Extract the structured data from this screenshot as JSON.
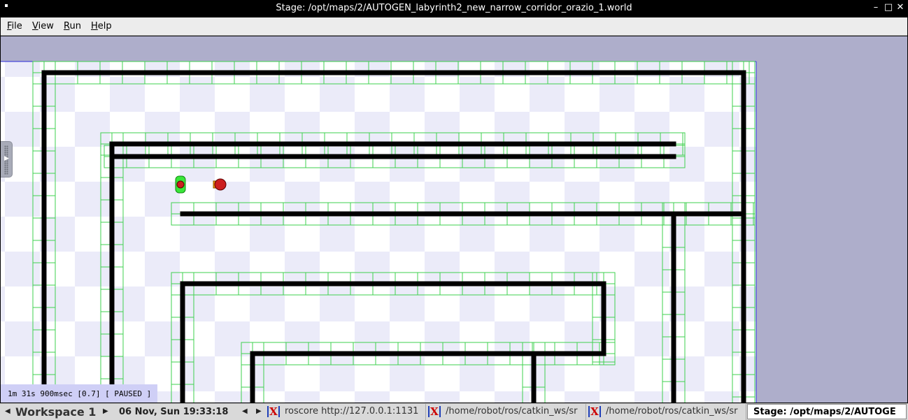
{
  "window": {
    "title": "Stage: /opt/maps/2/AUTOGEN_labyrinth2_new_narrow_corridor_orazio_1.world",
    "minimize_glyph": "–",
    "maximize_glyph": "□",
    "close_glyph": "✕"
  },
  "menu": {
    "file": {
      "mnemonic": "F",
      "rest": "ile"
    },
    "view": {
      "mnemonic": "V",
      "rest": "iew"
    },
    "run": {
      "mnemonic": "R",
      "rest": "un"
    },
    "help": {
      "mnemonic": "H",
      "rest": "elp"
    }
  },
  "simulation": {
    "status": "1m 31s 900msec [0.7] [ PAUSED ]",
    "colors": {
      "background": "#aeaecb",
      "floor_light": "#ffffff",
      "floor_checker": "#ebebf9",
      "grid": "#3fd04f",
      "wall": "#000000",
      "border": "#2b2bd8",
      "robot_body": "#cc1f1f",
      "robot_green": "#39e639",
      "robot_laser": "#ff9a00"
    },
    "robots": [
      {
        "name": "robot-green",
        "icon": "robot-green-icon"
      },
      {
        "name": "robot-red",
        "icon": "robot-red-icon"
      }
    ]
  },
  "taskbar": {
    "workspace": "Workspace 1",
    "datetime": "06 Nov, Sun 19:33:18",
    "left_arrow": "◀",
    "right_arrow": "▶",
    "prev_arrow": "◀",
    "next_arrow": "▶",
    "tasks": [
      {
        "label": "roscore http://127.0.0.1:1131",
        "icon": "xterm-icon"
      },
      {
        "label": "/home/robot/ros/catkin_ws/sr",
        "icon": "xterm-icon"
      },
      {
        "label": "/home/robot/ros/catkin_ws/sr",
        "icon": "xterm-icon"
      },
      {
        "label": "Stage: /opt/maps/2/AUTOGE",
        "icon": ""
      }
    ],
    "xterm_glyph": "X"
  }
}
